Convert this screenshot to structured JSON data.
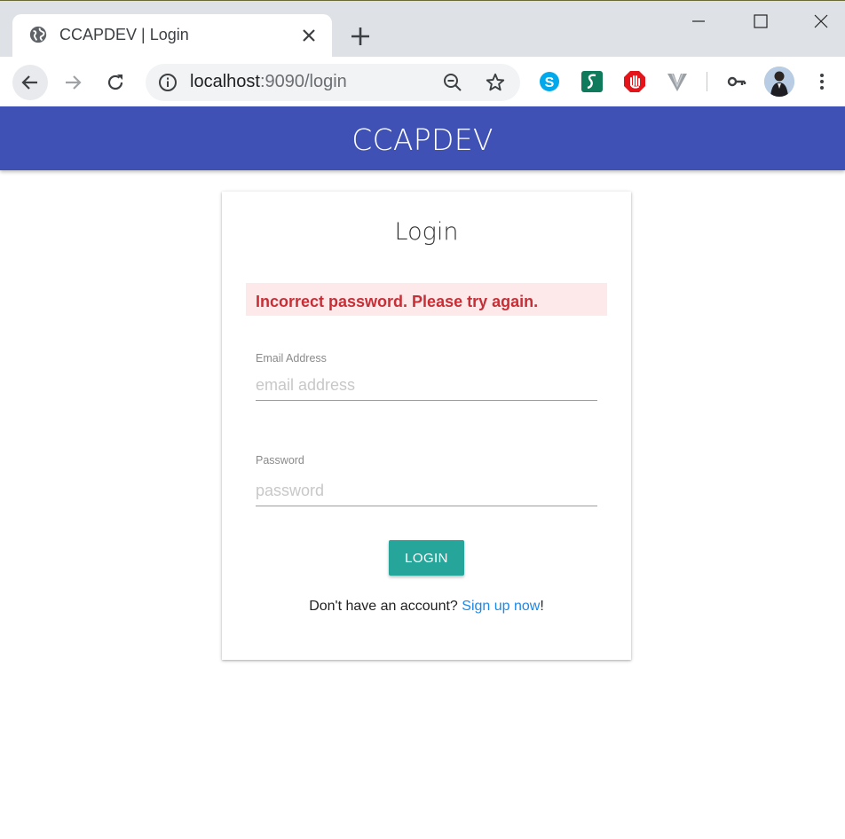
{
  "browser": {
    "tab_title": "CCAPDEV | Login",
    "url_host": "localhost",
    "url_path": ":9090/login"
  },
  "header": {
    "title": "CCAPDEV"
  },
  "login_card": {
    "title": "Login",
    "error_message": "Incorrect password. Please try again.",
    "email": {
      "label": "Email Address",
      "placeholder": "email address",
      "value": ""
    },
    "password": {
      "label": "Password",
      "placeholder": "password",
      "value": ""
    },
    "submit_label": "LOGIN",
    "signup_prompt": "Don't have an account? ",
    "signup_link": "Sign up now",
    "signup_suffix": "!"
  },
  "colors": {
    "header_bg": "#3f51b5",
    "button_bg": "#26a69a",
    "error_bg": "#fde8ea",
    "error_text": "#c62f36",
    "link": "#1e88e5"
  },
  "icons": {
    "tab_favicon": "globe-icon",
    "tab_close": "close-icon",
    "new_tab": "plus-icon",
    "back": "arrow-left-icon",
    "forward": "arrow-right-icon",
    "reload": "reload-icon",
    "site_info": "info-icon",
    "zoom": "zoom-out-icon",
    "bookmark": "star-icon",
    "extensions": [
      "skype-icon",
      "s-extension-icon",
      "stop-hand-icon",
      "v-extension-icon"
    ],
    "passwords": "key-icon",
    "profile": "avatar",
    "menu": "more-vert-icon"
  }
}
